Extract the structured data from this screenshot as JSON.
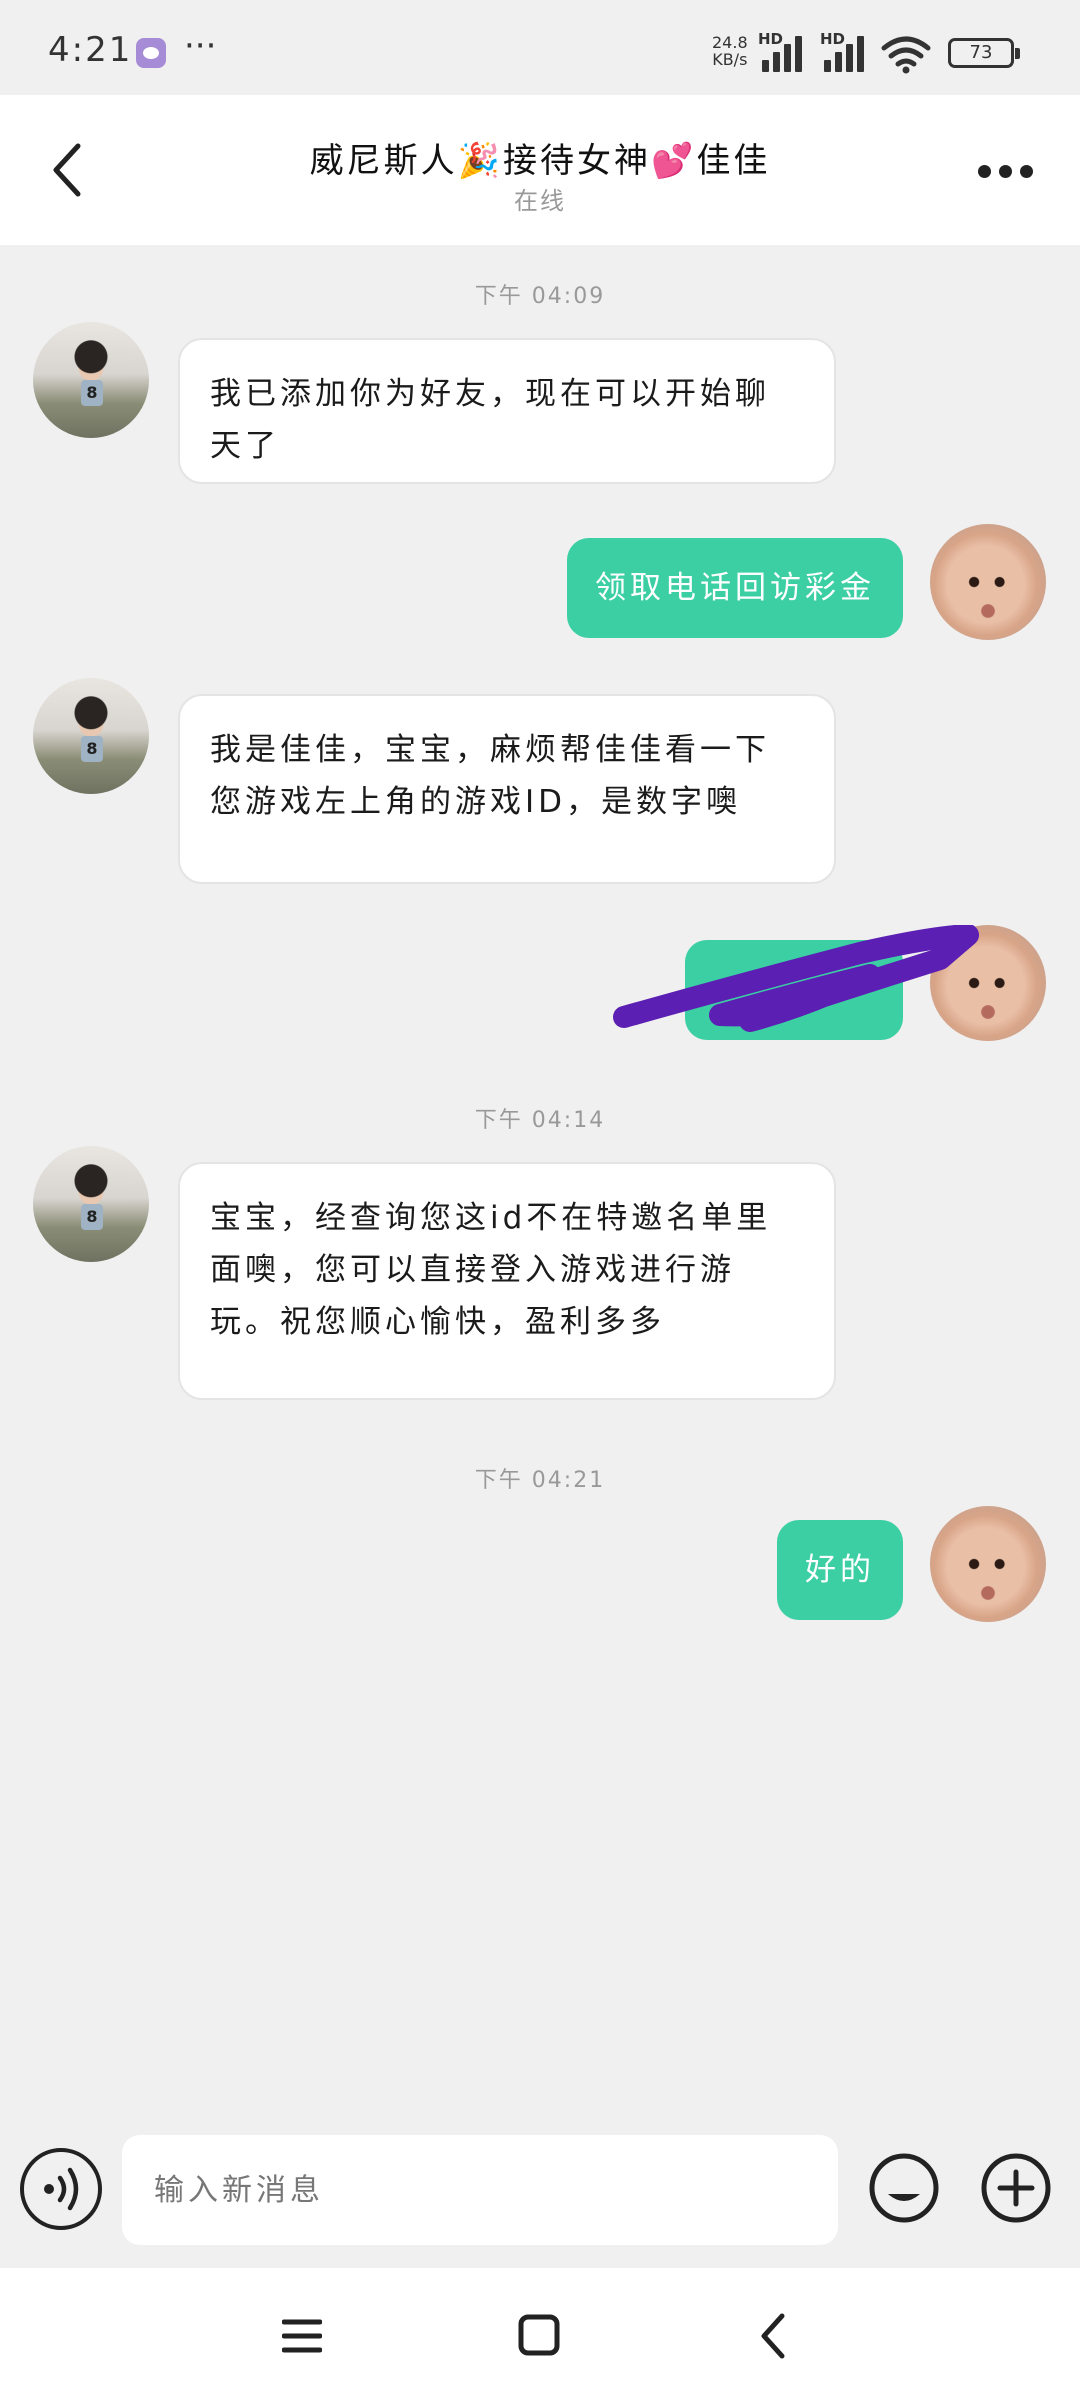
{
  "status_bar": {
    "time": "4:21",
    "more": "···",
    "net_speed_value": "24.8",
    "net_speed_unit": "KB/s",
    "signal_1_label": "HD",
    "signal_2_label": "HD",
    "battery": "73"
  },
  "header": {
    "title": "威尼斯人🎉接待女神💕佳佳",
    "status": "在线"
  },
  "messages": {
    "ts1": "下午 04:09",
    "m1": "我已添加你为好友，现在可以开始聊天了",
    "m2": "领取电话回访彩金",
    "m3": "我是佳佳，宝宝，麻烦帮佳佳看一下您游戏左上角的游戏ID，是数字噢",
    "ts2": "下午 04:14",
    "m5": "宝宝，经查询您这id不在特邀名单里面噢，您可以直接登入游戏进行游玩。祝您顺心愉快，盈利多多",
    "ts3": "下午 04:21",
    "m6": "好的"
  },
  "input": {
    "placeholder": "输入新消息"
  },
  "colors": {
    "accent_bubble": "#3ccfa4",
    "scribble": "#5b1fb3",
    "background": "#f0f0f0"
  },
  "icons": [
    "back-icon",
    "more-icon",
    "voice-icon",
    "emoji-icon",
    "plus-icon",
    "menu-icon",
    "home-icon",
    "nav-back-icon"
  ]
}
